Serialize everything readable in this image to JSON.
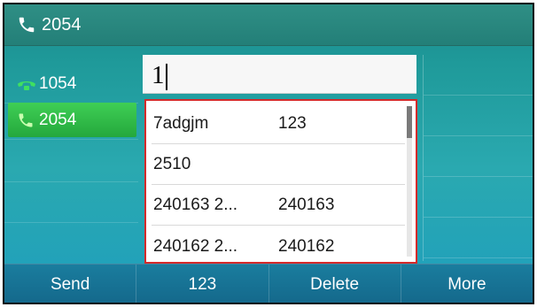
{
  "titlebar": {
    "account": "2054",
    "icon": "phone-handset-icon"
  },
  "lines": [
    {
      "label": "1054",
      "icon": "phone-ringing-icon",
      "icon_color": "#3fe060",
      "active": false
    },
    {
      "label": "2054",
      "icon": "phone-handset-icon",
      "icon_color": "#c9ffb0",
      "active": true
    }
  ],
  "input": {
    "value": "1"
  },
  "suggestions": [
    {
      "name": "7adgjm",
      "number": "123"
    },
    {
      "name": "2510",
      "number": ""
    },
    {
      "name": "240163 2...",
      "number": "240163"
    },
    {
      "name": "240162 2...",
      "number": "240162"
    }
  ],
  "softkeys": [
    {
      "label": "Send"
    },
    {
      "label": "123"
    },
    {
      "label": "Delete"
    },
    {
      "label": "More"
    }
  ],
  "colors": {
    "highlight_border": "#d42a2a",
    "active_line": "#2db845"
  }
}
